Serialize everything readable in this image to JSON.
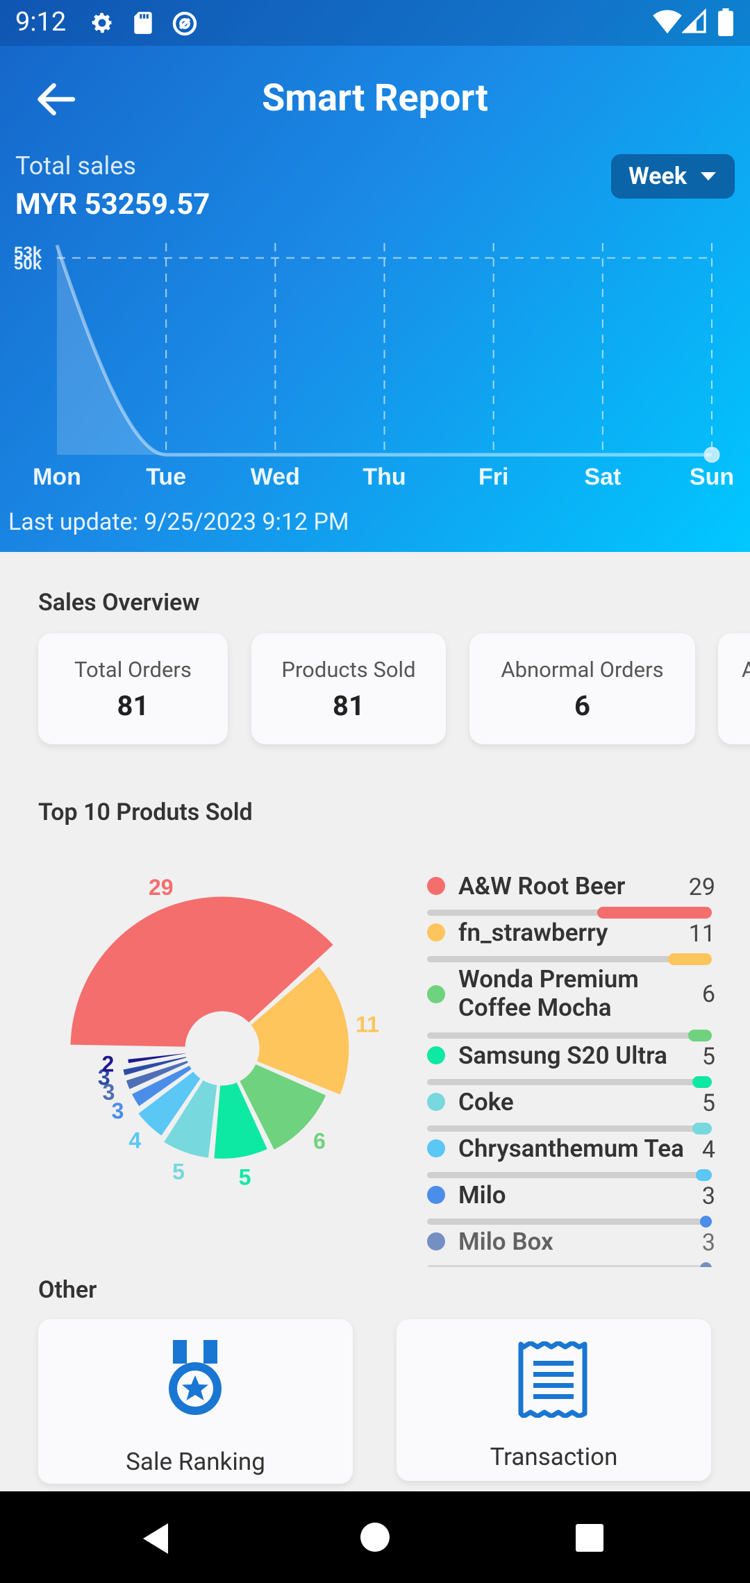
{
  "status_bar": {
    "time": "9:12"
  },
  "app_bar": {
    "title": "Smart Report"
  },
  "summary": {
    "total_label": "Total sales",
    "total_value": "MYR 53259.57",
    "period": "Week",
    "last_update": "Last update: 9/25/2023 9:12 PM"
  },
  "chart_data": [
    {
      "type": "area",
      "x": [
        "Mon",
        "Tue",
        "Wed",
        "Thu",
        "Fri",
        "Sat",
        "Sun"
      ],
      "values": [
        53259.57,
        0,
        0,
        0,
        0,
        0,
        0
      ],
      "ytick_labels": [
        "53k",
        "50k"
      ],
      "grid": true
    },
    {
      "type": "pie",
      "categories": [
        "A&W Root Beer",
        "fn_strawberry",
        "Wonda Premium Coffee Mocha",
        "Samsung S20 Ultra",
        "Coke",
        "Chrysanthemum Tea",
        "Milo",
        "Milo Box",
        "(unlabeled)",
        "(unlabeled)"
      ],
      "values": [
        29,
        11,
        6,
        5,
        5,
        4,
        3,
        3,
        3,
        2
      ],
      "colors": [
        "#f46e6e",
        "#fec55d",
        "#6fd27e",
        "#0de8a3",
        "#77d8de",
        "#5ac7f5",
        "#4a8ee9",
        "#4e6fb5",
        "#2d4ba6",
        "#1f1a8a"
      ]
    }
  ],
  "chart_labels": {
    "y_ticks": [
      "53k",
      "50k"
    ],
    "x_ticks": [
      "Mon",
      "Tue",
      "Wed",
      "Thu",
      "Fri",
      "Sat",
      "Sun"
    ],
    "pie_values": [
      "29",
      "11",
      "6",
      "5",
      "5",
      "4",
      "3",
      "3",
      "3",
      "2"
    ]
  },
  "overview": {
    "title": "Sales Overview",
    "cards": [
      {
        "label": "Total Orders",
        "value": "81"
      },
      {
        "label": "Products Sold",
        "value": "81"
      },
      {
        "label": "Abnormal Orders",
        "value": "6"
      },
      {
        "label": "A",
        "value": ""
      }
    ]
  },
  "top_products": {
    "title": "Top 10 Produts Sold",
    "items": [
      {
        "name": "A&W Root Beer",
        "value": "29",
        "color": "#f46e6e"
      },
      {
        "name": "fn_strawberry",
        "value": "11",
        "color": "#fec55d"
      },
      {
        "name": "Wonda Premium Coffee Mocha",
        "value": "6",
        "color": "#6fd27e"
      },
      {
        "name": "Samsung S20 Ultra",
        "value": "5",
        "color": "#0de8a3"
      },
      {
        "name": "Coke",
        "value": "5",
        "color": "#77d8de"
      },
      {
        "name": "Chrysanthemum Tea",
        "value": "4",
        "color": "#5ac7f5"
      },
      {
        "name": "Milo",
        "value": "3",
        "color": "#4a8ee9"
      },
      {
        "name": "Milo Box",
        "value": "3",
        "color": "#4e6fb5"
      }
    ]
  },
  "other": {
    "title": "Other",
    "items": [
      {
        "label": "Sale Ranking",
        "icon": "medal-icon"
      },
      {
        "label": "Transaction",
        "icon": "receipt-icon"
      }
    ]
  },
  "colors": {
    "header_start": "#1565c8",
    "header_end": "#00c8ff",
    "icon_blue": "#1976d2"
  }
}
